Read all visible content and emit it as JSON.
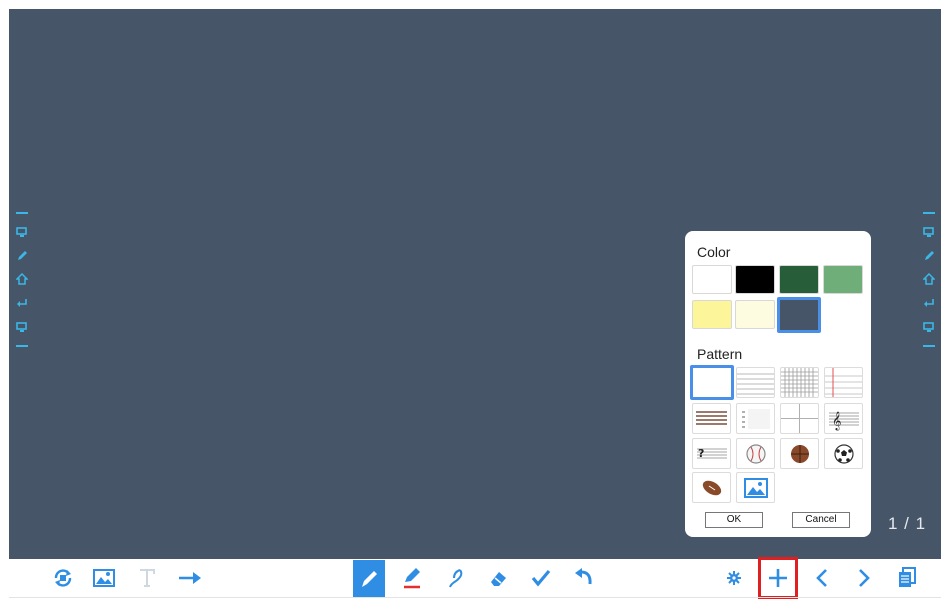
{
  "theme": {
    "board_color": "#465568",
    "accent": "#2f8ee3",
    "side_icon_color": "#3ab7e6",
    "highlight": "#e02020"
  },
  "page_indicator": "1 / 1",
  "side_icons": [
    "screen-icon",
    "pen-icon",
    "home-icon",
    "back-icon",
    "screen-icon"
  ],
  "panel": {
    "color_label": "Color",
    "pattern_label": "Pattern",
    "colors": [
      {
        "name": "white",
        "hex": "#ffffff",
        "selected": false
      },
      {
        "name": "black",
        "hex": "#000000",
        "selected": false
      },
      {
        "name": "dark-green",
        "hex": "#285d3a",
        "selected": false
      },
      {
        "name": "light-green",
        "hex": "#6fae79",
        "selected": false
      },
      {
        "name": "yellow",
        "hex": "#fdf59a",
        "selected": false
      },
      {
        "name": "cream",
        "hex": "#fdfbe0",
        "selected": false
      },
      {
        "name": "slate",
        "hex": "#465568",
        "selected": true
      }
    ],
    "patterns": [
      "blank-pattern-icon",
      "lined-pattern-icon",
      "grid-pattern-icon",
      "notebook-pattern-icon",
      "brown-lines-pattern-icon",
      "dotted-list-pattern-icon",
      "quadrant-pattern-icon",
      "treble-staff-pattern-icon",
      "bass-staff-pattern-icon",
      "baseball-pattern-icon",
      "basketball-pattern-icon",
      "soccer-pattern-icon",
      "football-pattern-icon",
      "image-pattern-icon"
    ],
    "ok_label": "OK",
    "cancel_label": "Cancel"
  },
  "toolbar": {
    "left": [
      "refresh-icon",
      "image-icon",
      "text-icon",
      "arrow-right-icon"
    ],
    "center": [
      "pen-icon",
      "highlighter-icon",
      "lasso-icon",
      "eraser-icon",
      "check-icon",
      "undo-icon"
    ],
    "right": [
      "settings-icon",
      "add-page-icon",
      "prev-page-icon",
      "next-page-icon",
      "pages-icon"
    ],
    "active_tool": "pen-icon",
    "highlighted_button": "add-page-icon"
  }
}
